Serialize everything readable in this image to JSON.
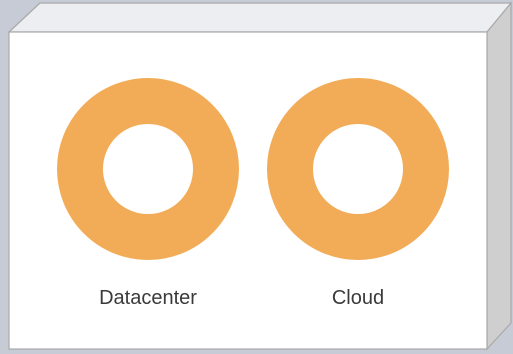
{
  "colors": {
    "background": "#c7cbd6",
    "box_front": "#ffffff",
    "box_top": "#eceef2",
    "box_side": "#cfcfcf",
    "box_outline": "#a9a9a9",
    "ring": "#f2ac58",
    "label_text": "#3a3a3a"
  },
  "box": {
    "shape": "3d-box"
  },
  "rings": [
    {
      "label": "Datacenter",
      "icon": "ring-icon"
    },
    {
      "label": "Cloud",
      "icon": "ring-icon"
    }
  ]
}
